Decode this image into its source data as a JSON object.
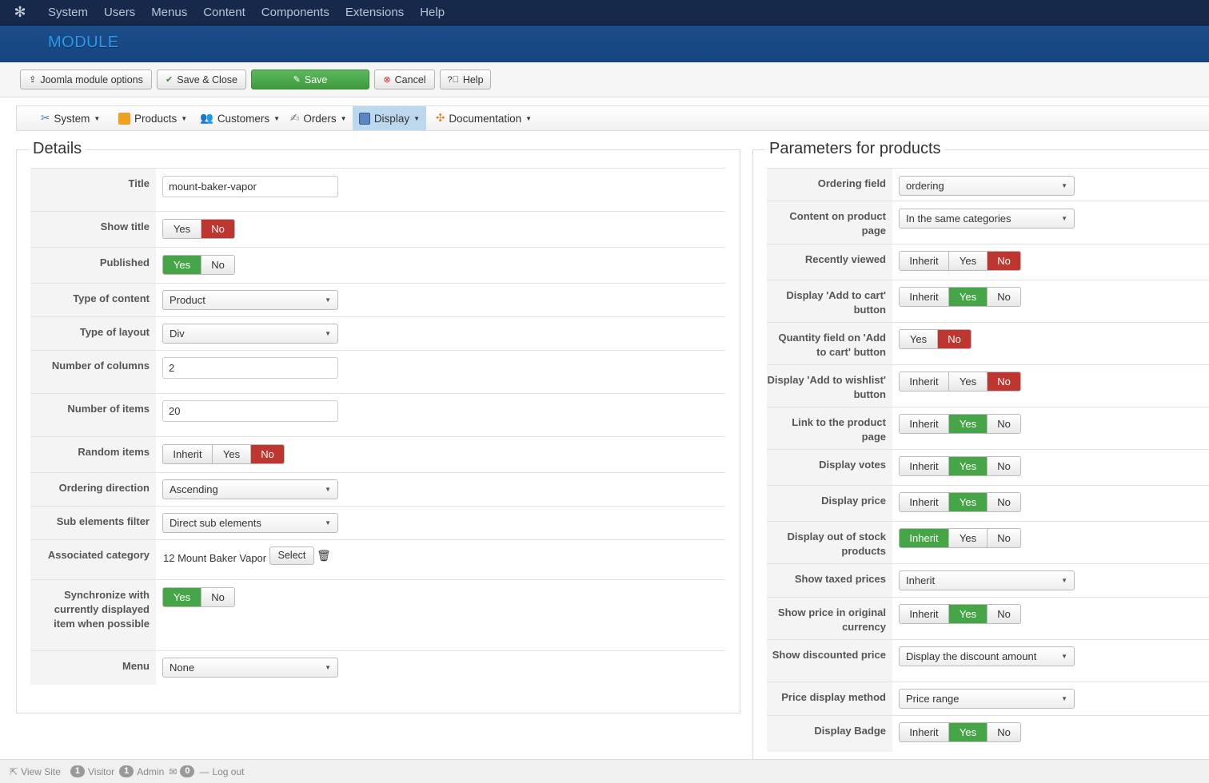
{
  "topnav": {
    "items": [
      "System",
      "Users",
      "Menus",
      "Content",
      "Components",
      "Extensions",
      "Help"
    ]
  },
  "header": {
    "title": "MODULE"
  },
  "toolbar": {
    "options_label": "Joomla module options",
    "save_close_label": "Save & Close",
    "save_label": "Save",
    "cancel_label": "Cancel",
    "help_label": "Help"
  },
  "submenu": {
    "items": [
      "System",
      "Products",
      "Customers",
      "Orders",
      "Display",
      "Documentation"
    ],
    "active": "Display"
  },
  "details": {
    "legend": "Details",
    "title_label": "Title",
    "title_value": "mount-baker-vapor",
    "show_title_label": "Show title",
    "published_label": "Published",
    "type_content_label": "Type of content",
    "type_content_value": "Product",
    "type_layout_label": "Type of layout",
    "type_layout_value": "Div",
    "columns_label": "Number of columns",
    "columns_value": "2",
    "items_label": "Number of items",
    "items_value": "20",
    "random_label": "Random items",
    "ordering_dir_label": "Ordering direction",
    "ordering_dir_value": "Ascending",
    "sub_filter_label": "Sub elements filter",
    "sub_filter_value": "Direct sub elements",
    "assoc_cat_label": "Associated category",
    "assoc_cat_value": "12 Mount Baker Vapor",
    "select_label": "Select",
    "sync_label": "Synchronize with currently displayed item when possible",
    "menu_label": "Menu",
    "menu_value": "None"
  },
  "params": {
    "legend": "Parameters for products",
    "ordering_field_label": "Ordering field",
    "ordering_field_value": "ordering",
    "content_page_label": "Content on product page",
    "content_page_value": "In the same categories",
    "recently_viewed_label": "Recently viewed",
    "add_cart_label": "Display 'Add to cart' button",
    "qty_field_label": "Quantity field on 'Add to cart' button",
    "wishlist_label": "Display 'Add to wishlist' button",
    "link_product_label": "Link to the product page",
    "votes_label": "Display votes",
    "price_label": "Display price",
    "out_stock_label": "Display out of stock products",
    "taxed_label": "Show taxed prices",
    "taxed_value": "Inherit",
    "orig_currency_label": "Show price in original currency",
    "discounted_label": "Show discounted price",
    "discounted_value": "Display the discount amount",
    "price_method_label": "Price display method",
    "price_method_value": "Price range",
    "badge_label": "Display Badge"
  },
  "toggle_labels": {
    "inherit": "Inherit",
    "yes": "Yes",
    "no": "No"
  },
  "statusbar": {
    "view_site": "View Site",
    "visitor_count": "1",
    "visitor_label": "Visitor",
    "admin_count": "1",
    "admin_label": "Admin",
    "messages_count": "0",
    "logout": "Log out"
  },
  "colors": {
    "toggle_green": "#46a546",
    "toggle_red": "#bd362f",
    "header_blue": "#1c4d8a"
  }
}
